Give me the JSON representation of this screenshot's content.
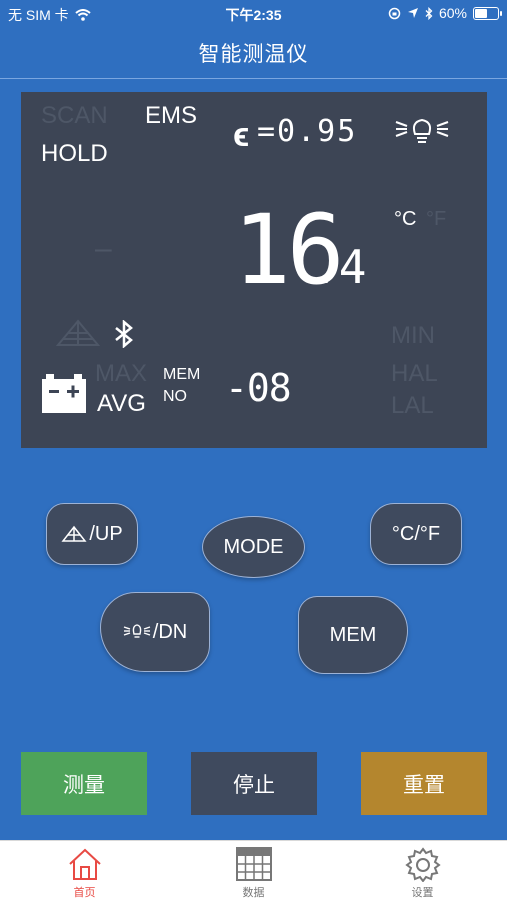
{
  "status_bar": {
    "carrier": "无 SIM 卡",
    "time": "下午2:35",
    "battery": "60%",
    "battery_level": 0.6
  },
  "nav": {
    "title": "智能测温仪"
  },
  "lcd": {
    "scan": "SCAN",
    "ems": "EMS",
    "hold": "HOLD",
    "emissivity": "=0.95",
    "emissivity_symbol": "ϵ",
    "temperature_int": "16",
    "temperature_dec": ".4",
    "dash": "–",
    "unit_c": "°C",
    "unit_f": "°F",
    "max": "MAX",
    "avg": "AVG",
    "mem": "MEM",
    "no": "NO",
    "mem_no_value": "-08",
    "min": "MIN",
    "hal": "HAL",
    "lal": "LAL",
    "colors": {
      "bg": "#3d4555",
      "on": "#ffffff",
      "off": "#4e5767"
    }
  },
  "controls": {
    "up": "/UP",
    "mode": "MODE",
    "unit": "°C/°F",
    "dn": "/DN",
    "mem": "MEM"
  },
  "actions": {
    "measure": "测量",
    "stop": "停止",
    "reset": "重置",
    "colors": {
      "measure": "#4ea35a",
      "stop": "#3f4a5e",
      "reset": "#b4862e"
    }
  },
  "tabs": [
    {
      "label": "首页",
      "active": true
    },
    {
      "label": "数据",
      "active": false
    },
    {
      "label": "设置",
      "active": false
    }
  ],
  "icons": [
    "wifi-icon",
    "rotation-lock-icon",
    "location-icon",
    "bluetooth-icon",
    "battery-icon",
    "laser-icon",
    "lightbulb-icon",
    "battery-low-icon",
    "home-icon",
    "grid-icon",
    "gear-icon"
  ]
}
